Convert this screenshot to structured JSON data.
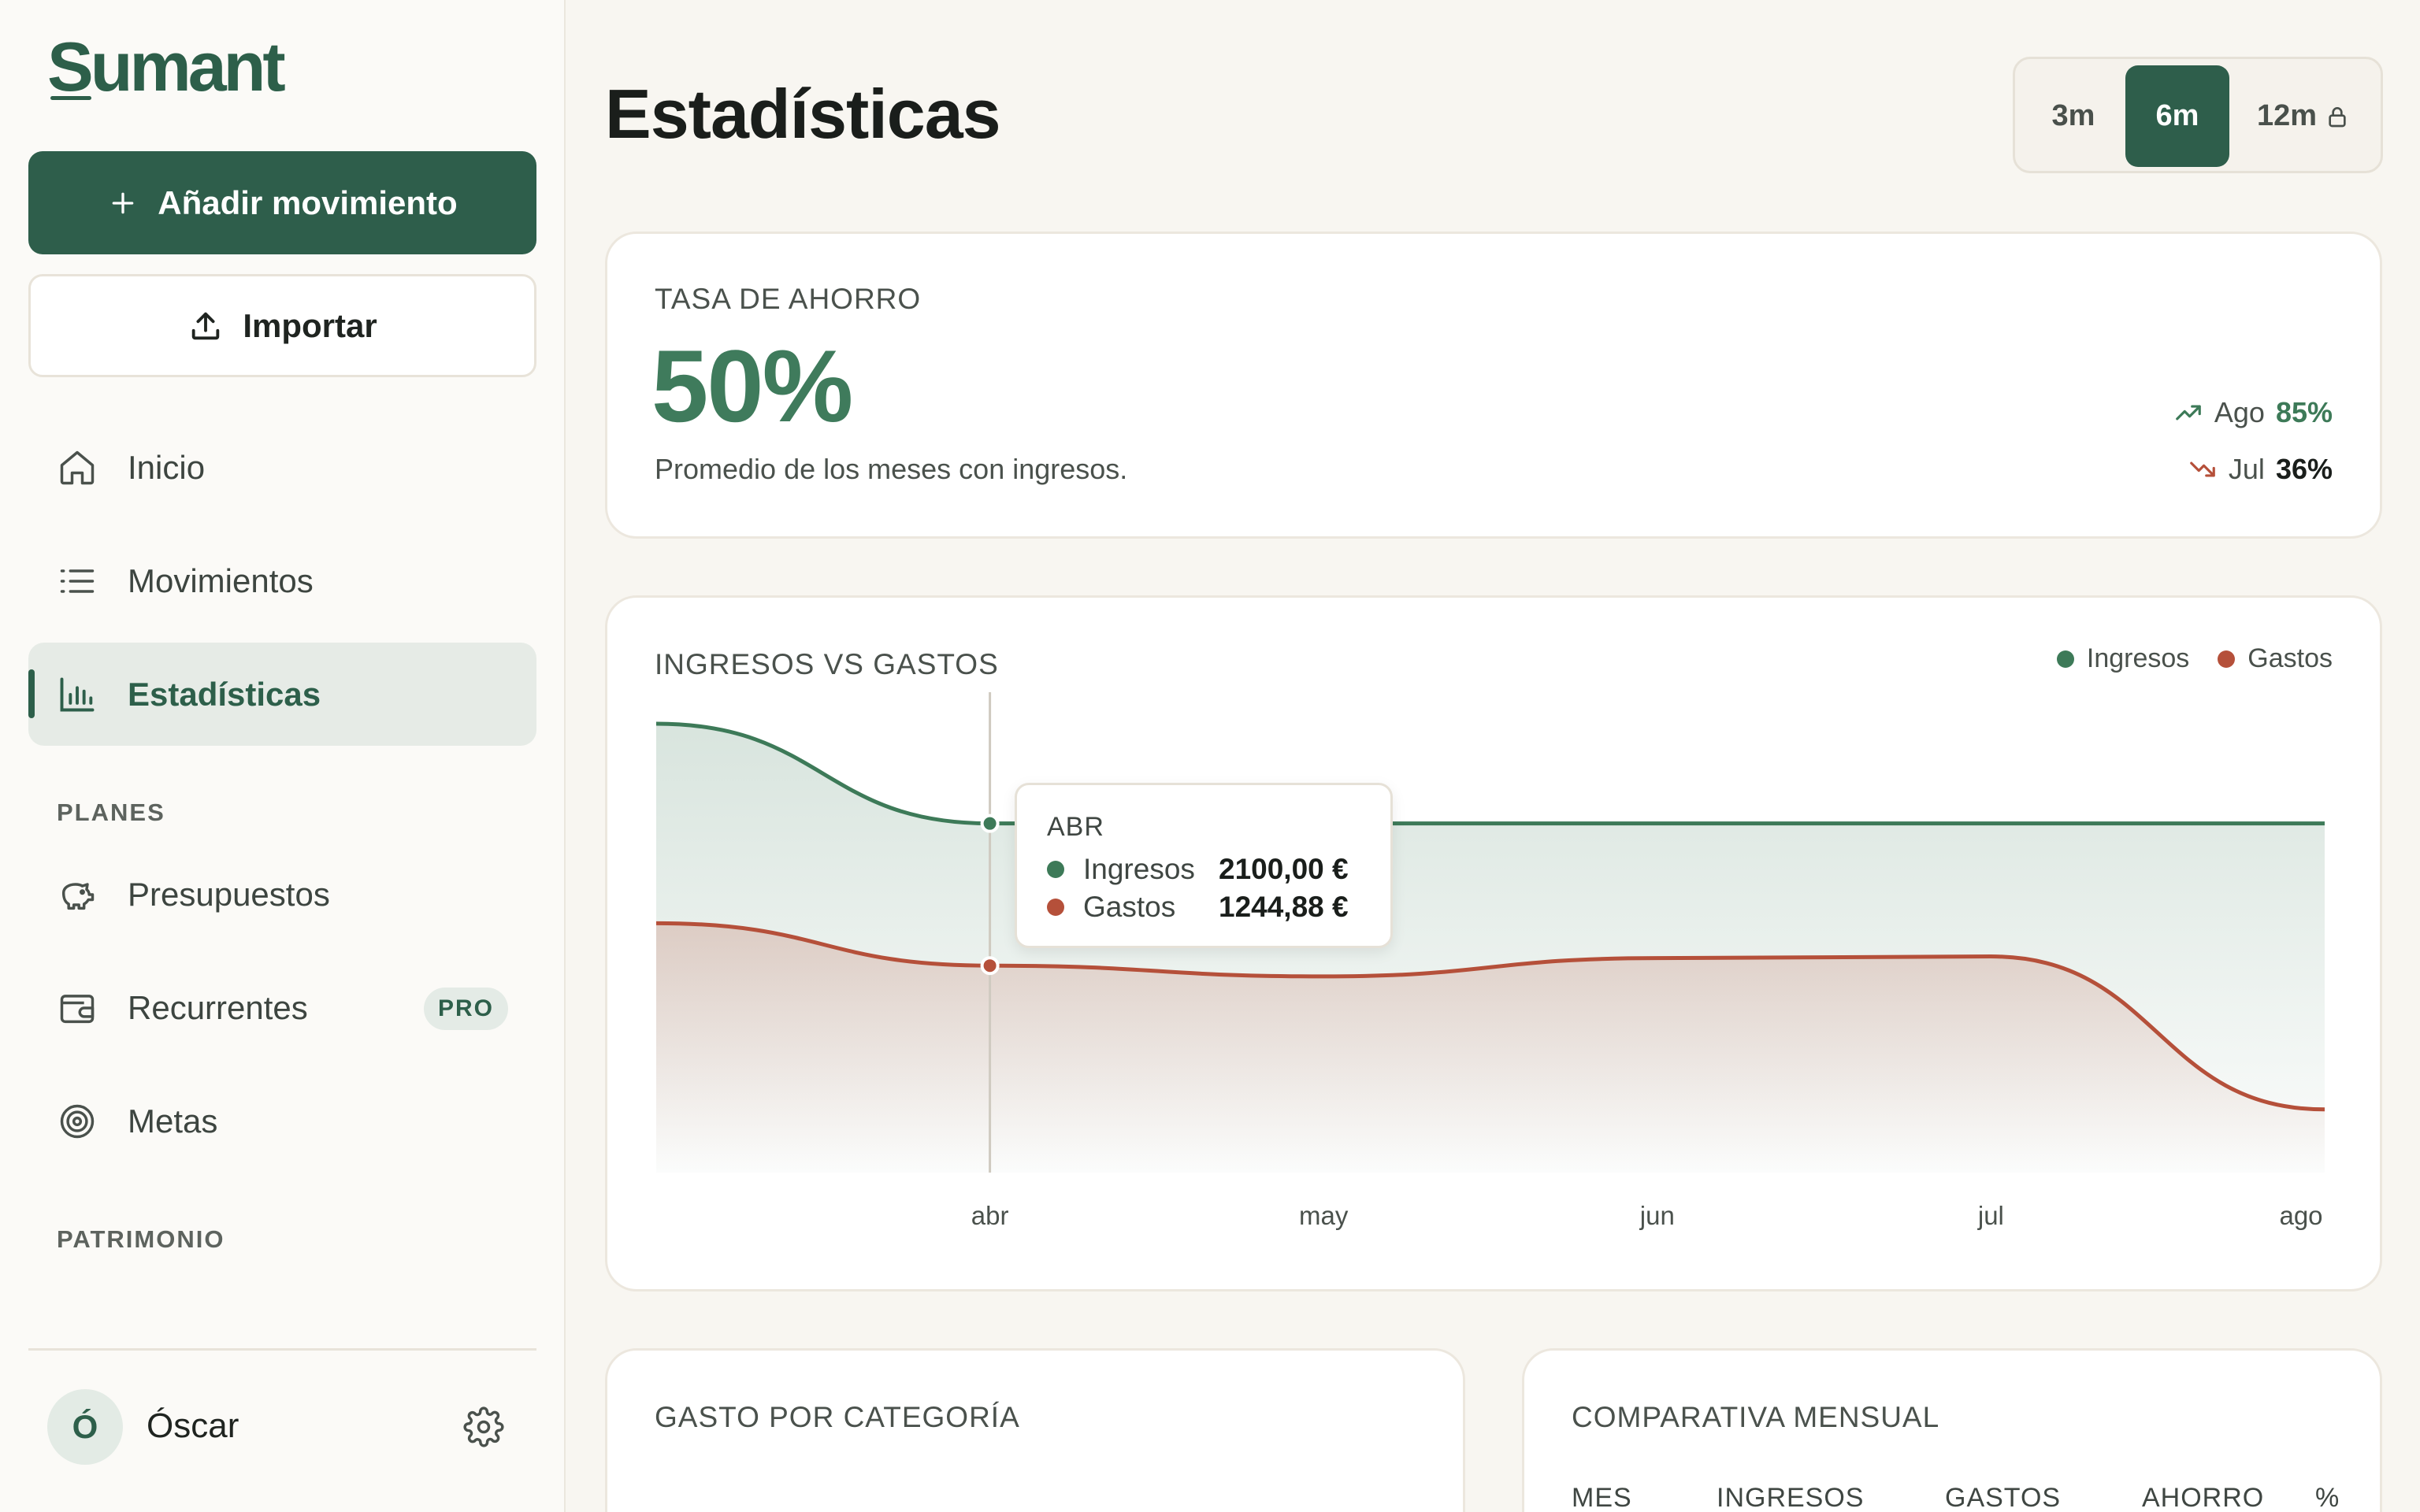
{
  "sidebar": {
    "logo": "Sumant",
    "add_label": "Añadir movimiento",
    "import_label": "Importar",
    "nav": [
      {
        "label": "Inicio",
        "icon": "home-icon"
      },
      {
        "label": "Movimientos",
        "icon": "list-icon"
      },
      {
        "label": "Estadísticas",
        "icon": "bar-chart-icon",
        "active": true
      }
    ],
    "planes_label": "PLANES",
    "planes": [
      {
        "label": "Presupuestos",
        "icon": "piggy-bank-icon"
      },
      {
        "label": "Recurrentes",
        "icon": "wallet-icon",
        "badge": "PRO"
      },
      {
        "label": "Metas",
        "icon": "target-icon"
      }
    ],
    "patrimonio_label": "PATRIMONIO",
    "user": {
      "initial": "Ó",
      "name": "Óscar"
    }
  },
  "header": {
    "title": "Estadísticas",
    "ranges": [
      {
        "label": "3m"
      },
      {
        "label": "6m",
        "active": true
      },
      {
        "label": "12m",
        "locked": true
      }
    ]
  },
  "savings": {
    "label": "TASA DE AHORRO",
    "value": "50%",
    "subtitle": "Promedio de los meses con ingresos.",
    "best": {
      "month": "Ago",
      "value": "85%"
    },
    "worst": {
      "month": "Jul",
      "value": "36%"
    }
  },
  "income_vs_expenses": {
    "label": "INGRESOS VS GASTOS",
    "legend": {
      "income": "Ingresos",
      "expenses": "Gastos"
    },
    "tooltip": {
      "month": "ABR",
      "income_label": "Ingresos",
      "income_value": "2100,00 €",
      "expenses_label": "Gastos",
      "expenses_value": "1244,88 €"
    }
  },
  "chart_data": {
    "type": "area",
    "x": [
      "abr",
      "may",
      "jun",
      "jul",
      "ago"
    ],
    "series": [
      {
        "name": "Ingresos",
        "values": [
          2100,
          2100,
          2100,
          2100,
          2100
        ],
        "color": "#3d7a58"
      },
      {
        "name": "Gastos",
        "values": [
          1244.88,
          1180,
          1290,
          1300,
          380
        ],
        "color": "#b5503a"
      }
    ],
    "ylim": [
      0,
      2700
    ],
    "grid": false,
    "legend_position": "top-right"
  },
  "bottom": {
    "category_label": "GASTO POR CATEGORÍA",
    "monthly_label": "COMPARATIVA MENSUAL",
    "columns": [
      "MES",
      "INGRESOS",
      "GASTOS",
      "AHORRO",
      "%"
    ]
  },
  "colors": {
    "accent": "#2e5e4b",
    "income": "#3d7a58",
    "expenses": "#b5503a",
    "background": "#f8f6f1"
  }
}
